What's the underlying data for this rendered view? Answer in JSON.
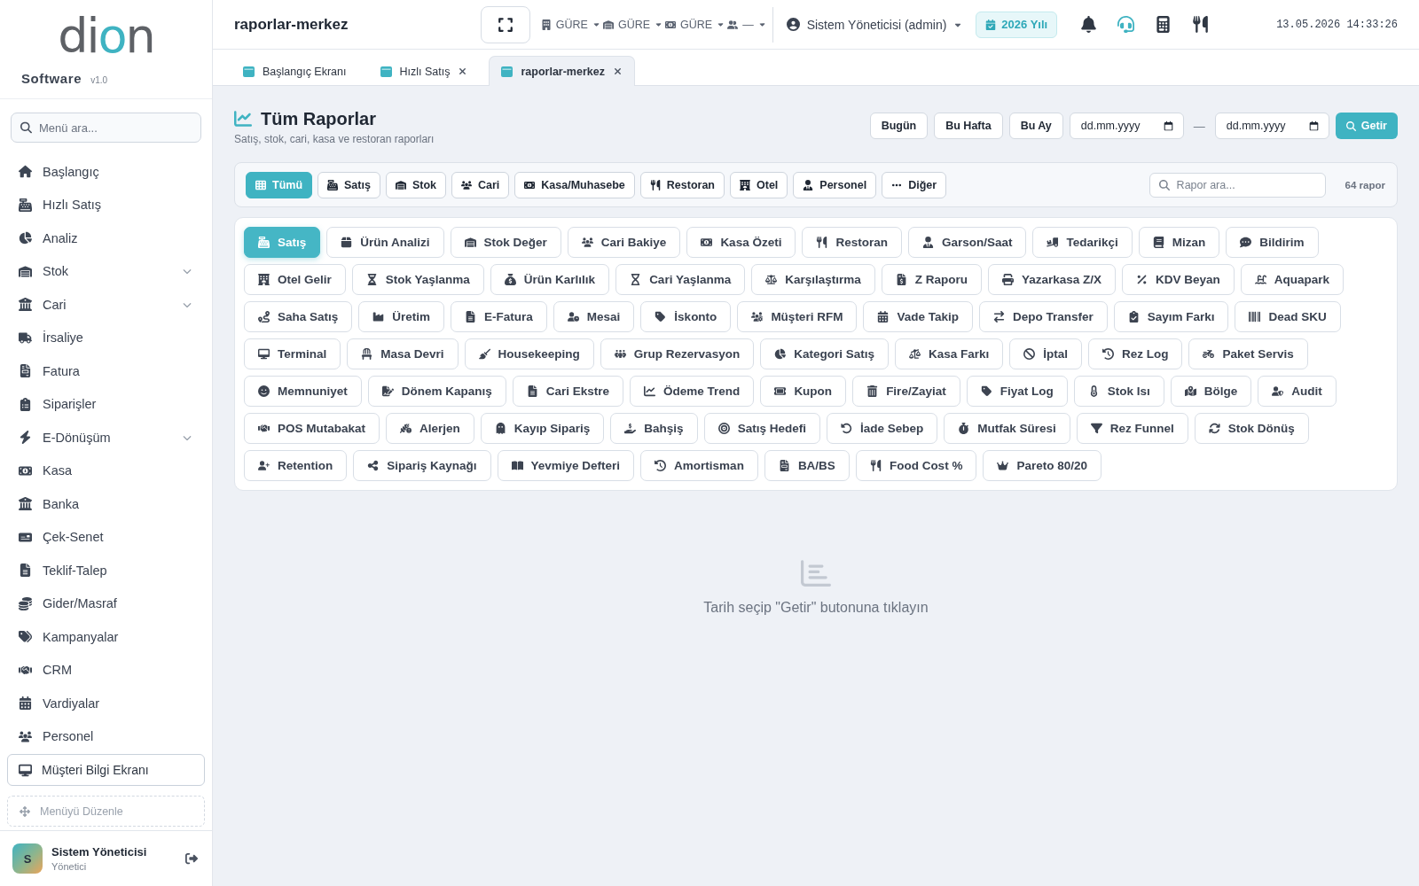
{
  "sidebar": {
    "logo": "dion",
    "product": "Software",
    "version": "v1.0",
    "search": {
      "placeholder": "Menü ara..."
    },
    "menu": [
      {
        "label": "Başlangıç",
        "expandable": false
      },
      {
        "label": "Hızlı Satış",
        "expandable": false
      },
      {
        "label": "Analiz",
        "expandable": false
      },
      {
        "label": "Stok",
        "expandable": true
      },
      {
        "label": "Cari",
        "expandable": true
      },
      {
        "label": "İrsaliye",
        "expandable": false
      },
      {
        "label": "Fatura",
        "expandable": false
      },
      {
        "label": "Siparişler",
        "expandable": false
      },
      {
        "label": "E-Dönüşüm",
        "expandable": true
      },
      {
        "label": "Kasa",
        "expandable": false
      },
      {
        "label": "Banka",
        "expandable": false
      },
      {
        "label": "Çek-Senet",
        "expandable": false
      },
      {
        "label": "Teklif-Talep",
        "expandable": false
      },
      {
        "label": "Gider/Masraf",
        "expandable": false
      },
      {
        "label": "Kampanyalar",
        "expandable": false
      },
      {
        "label": "CRM",
        "expandable": false
      },
      {
        "label": "Vardiyalar",
        "expandable": false
      },
      {
        "label": "Personel",
        "expandable": false
      }
    ],
    "customer_display_button": "Müşteri Bilgi Ekranı",
    "edit_menu_button": "Menüyü Düzenle",
    "user": {
      "initial": "S",
      "name": "Sistem Yöneticisi",
      "role": "Yönetici"
    }
  },
  "topbar": {
    "title": "raporlar-merkez",
    "selectors": [
      {
        "value": "GÜRE"
      },
      {
        "value": "GÜRE"
      },
      {
        "value": "GÜRE"
      },
      {
        "value": "—"
      }
    ],
    "user_menu": "Sistem Yöneticisi (admin)",
    "year_badge": "2026 Yılı",
    "datetime": "13.05.2026 14:33:26"
  },
  "tabs": [
    {
      "label": "Başlangıç Ekranı",
      "closable": false,
      "selected": false
    },
    {
      "label": "Hızlı Satış",
      "closable": true,
      "selected": false
    },
    {
      "label": "raporlar-merkez",
      "closable": true,
      "selected": true
    }
  ],
  "page": {
    "title": "Tüm Raporlar",
    "subtitle": "Satış, stok, cari, kasa ve restoran raporları",
    "quick_ranges": [
      "Bugün",
      "Bu Hafta",
      "Bu Ay"
    ],
    "date_from": {
      "placeholder": "dd.mm.yyyy"
    },
    "date_separator": "—",
    "date_to": {
      "placeholder": "dd.mm.yyyy"
    },
    "fetch_button": "Getir"
  },
  "filter_bar": {
    "categories": [
      {
        "label": "Tümü",
        "selected": true
      },
      {
        "label": "Satış",
        "selected": false
      },
      {
        "label": "Stok",
        "selected": false
      },
      {
        "label": "Cari",
        "selected": false
      },
      {
        "label": "Kasa/Muhasebe",
        "selected": false
      },
      {
        "label": "Restoran",
        "selected": false
      },
      {
        "label": "Otel",
        "selected": false
      },
      {
        "label": "Personel",
        "selected": false
      },
      {
        "label": "Diğer",
        "selected": false
      }
    ],
    "search": {
      "placeholder": "Rapor ara..."
    },
    "report_count": "64 rapor"
  },
  "reports": [
    {
      "label": "Satış",
      "selected": true
    },
    {
      "label": "Ürün Analizi",
      "selected": false
    },
    {
      "label": "Stok Değer",
      "selected": false
    },
    {
      "label": "Cari Bakiye",
      "selected": false
    },
    {
      "label": "Kasa Özeti",
      "selected": false
    },
    {
      "label": "Restoran",
      "selected": false
    },
    {
      "label": "Garson/Saat",
      "selected": false
    },
    {
      "label": "Tedarikçi",
      "selected": false
    },
    {
      "label": "Mizan",
      "selected": false
    },
    {
      "label": "Bildirim",
      "selected": false
    },
    {
      "label": "Otel Gelir",
      "selected": false
    },
    {
      "label": "Stok Yaşlanma",
      "selected": false
    },
    {
      "label": "Ürün Karlılık",
      "selected": false
    },
    {
      "label": "Cari Yaşlanma",
      "selected": false
    },
    {
      "label": "Karşılaştırma",
      "selected": false
    },
    {
      "label": "Z Raporu",
      "selected": false
    },
    {
      "label": "Yazarkasa Z/X",
      "selected": false
    },
    {
      "label": "KDV Beyan",
      "selected": false
    },
    {
      "label": "Aquapark",
      "selected": false
    },
    {
      "label": "Saha Satış",
      "selected": false
    },
    {
      "label": "Üretim",
      "selected": false
    },
    {
      "label": "E-Fatura",
      "selected": false
    },
    {
      "label": "Mesai",
      "selected": false
    },
    {
      "label": "İskonto",
      "selected": false
    },
    {
      "label": "Müşteri RFM",
      "selected": false
    },
    {
      "label": "Vade Takip",
      "selected": false
    },
    {
      "label": "Depo Transfer",
      "selected": false
    },
    {
      "label": "Sayım Farkı",
      "selected": false
    },
    {
      "label": "Dead SKU",
      "selected": false
    },
    {
      "label": "Terminal",
      "selected": false
    },
    {
      "label": "Masa Devri",
      "selected": false
    },
    {
      "label": "Housekeeping",
      "selected": false
    },
    {
      "label": "Grup Rezervasyon",
      "selected": false
    },
    {
      "label": "Kategori Satış",
      "selected": false
    },
    {
      "label": "Kasa Farkı",
      "selected": false
    },
    {
      "label": "İptal",
      "selected": false
    },
    {
      "label": "Rez Log",
      "selected": false
    },
    {
      "label": "Paket Servis",
      "selected": false
    },
    {
      "label": "Memnuniyet",
      "selected": false
    },
    {
      "label": "Dönem Kapanış",
      "selected": false
    },
    {
      "label": "Cari Ekstre",
      "selected": false
    },
    {
      "label": "Ödeme Trend",
      "selected": false
    },
    {
      "label": "Kupon",
      "selected": false
    },
    {
      "label": "Fire/Zayiat",
      "selected": false
    },
    {
      "label": "Fiyat Log",
      "selected": false
    },
    {
      "label": "Stok Isı",
      "selected": false
    },
    {
      "label": "Bölge",
      "selected": false
    },
    {
      "label": "Audit",
      "selected": false
    },
    {
      "label": "POS Mutabakat",
      "selected": false
    },
    {
      "label": "Alerjen",
      "selected": false
    },
    {
      "label": "Kayıp Sipariş",
      "selected": false
    },
    {
      "label": "Bahşiş",
      "selected": false
    },
    {
      "label": "Satış Hedefi",
      "selected": false
    },
    {
      "label": "İade Sebep",
      "selected": false
    },
    {
      "label": "Mutfak Süresi",
      "selected": false
    },
    {
      "label": "Rez Funnel",
      "selected": false
    },
    {
      "label": "Stok Dönüş",
      "selected": false
    },
    {
      "label": "Retention",
      "selected": false
    },
    {
      "label": "Sipariş Kaynağı",
      "selected": false
    },
    {
      "label": "Yevmiye Defteri",
      "selected": false
    },
    {
      "label": "Amortisman",
      "selected": false
    },
    {
      "label": "BA/BS",
      "selected": false
    },
    {
      "label": "Food Cost %",
      "selected": false
    },
    {
      "label": "Pareto 80/20",
      "selected": false
    }
  ],
  "empty_state": {
    "message": "Tarih seçip \"Getir\" butonuna tıklayın"
  }
}
